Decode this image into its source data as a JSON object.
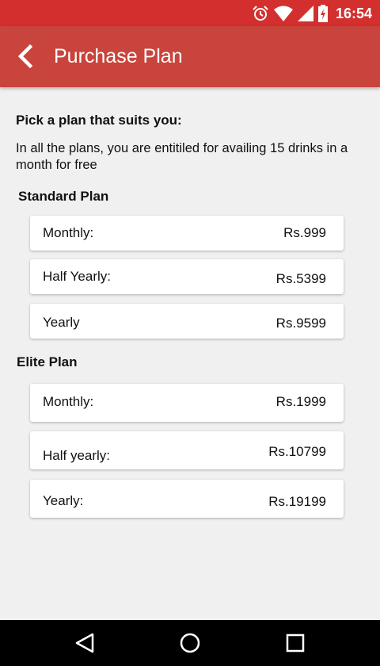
{
  "status_bar": {
    "time": "16:54",
    "icons": [
      "alarm-icon",
      "wifi-icon",
      "signal-icon",
      "battery-icon"
    ],
    "color": "#d32f2f"
  },
  "app_bar": {
    "title": "Purchase Plan",
    "back_icon": "chevron-left-icon",
    "color": "#c9443c"
  },
  "intro": {
    "heading": "Pick a plan that suits you:",
    "text": "In all the plans, you are entitiled for availing 15 drinks in a month for free"
  },
  "standard_plan": {
    "title": "Standard Plan",
    "options": [
      {
        "label": "Monthly:",
        "price": "Rs.999"
      },
      {
        "label": "Half Yearly:",
        "price": "Rs.5399"
      },
      {
        "label": "Yearly",
        "price": "Rs.9599"
      }
    ]
  },
  "elite_plan": {
    "title": "Elite Plan",
    "options": [
      {
        "label": "Monthly:",
        "price": "Rs.1999"
      },
      {
        "label": "Half yearly:",
        "price": "Rs.10799"
      },
      {
        "label": "Yearly:",
        "price": "Rs.19199"
      }
    ]
  },
  "nav_bar": {
    "buttons": [
      "back-triangle-icon",
      "home-circle-icon",
      "recents-square-icon"
    ]
  }
}
